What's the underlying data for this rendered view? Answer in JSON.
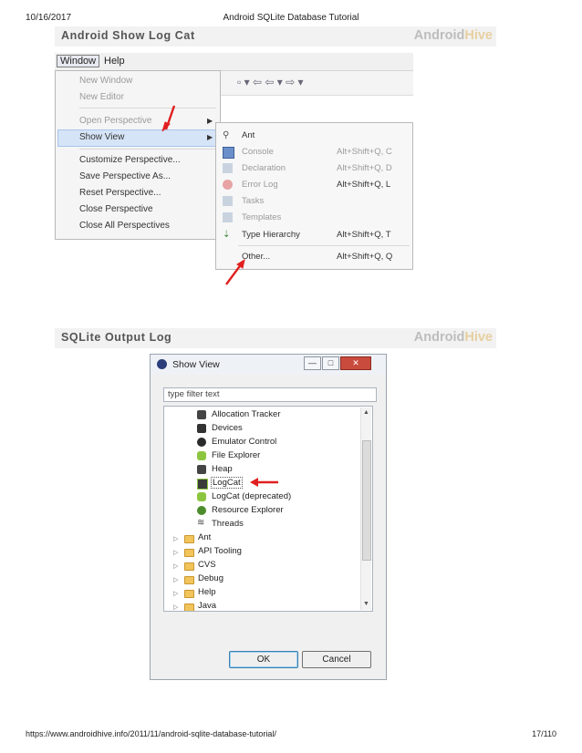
{
  "header": {
    "date": "10/16/2017",
    "title": "Android SQLite Database Tutorial"
  },
  "banner1": {
    "title": "Android Show Log Cat",
    "brand_a": "Android",
    "brand_b": "Hive"
  },
  "menubar": {
    "items": [
      "Window",
      "Help"
    ]
  },
  "window_menu": {
    "items": [
      "New Window",
      "New Editor",
      "Open Perspective",
      "Show View",
      "Customize Perspective...",
      "Save Perspective As...",
      "Reset Perspective...",
      "Close Perspective",
      "Close All Perspectives"
    ]
  },
  "show_view_menu": {
    "items": [
      {
        "label": "Ant",
        "shortcut": ""
      },
      {
        "label": "Console",
        "shortcut": "Alt+Shift+Q, C"
      },
      {
        "label": "Declaration",
        "shortcut": "Alt+Shift+Q, D"
      },
      {
        "label": "Error Log",
        "shortcut": "Alt+Shift+Q, L"
      },
      {
        "label": "Tasks",
        "shortcut": ""
      },
      {
        "label": "Templates",
        "shortcut": ""
      },
      {
        "label": "Type Hierarchy",
        "shortcut": "Alt+Shift+Q, T"
      },
      {
        "label": "Other...",
        "shortcut": "Alt+Shift+Q, Q"
      }
    ]
  },
  "banner2": {
    "title": "SQLite Output Log",
    "brand_a": "Android",
    "brand_b": "Hive"
  },
  "dialog": {
    "title": "Show View",
    "filter_placeholder": "type filter text",
    "children": [
      "Allocation Tracker",
      "Devices",
      "Emulator Control",
      "File Explorer",
      "Heap",
      "LogCat",
      "LogCat (deprecated)",
      "Resource Explorer",
      "Threads"
    ],
    "folders": [
      "Ant",
      "API Tooling",
      "CVS",
      "Debug",
      "Help",
      "Java"
    ],
    "ok_label": "OK",
    "cancel_label": "Cancel"
  },
  "footer": {
    "url": "https://www.androidhive.info/2011/11/android-sqlite-database-tutorial/",
    "page": "17/110"
  },
  "colors": {
    "arrow": "#e02020",
    "selection": "#d5e4f7"
  }
}
